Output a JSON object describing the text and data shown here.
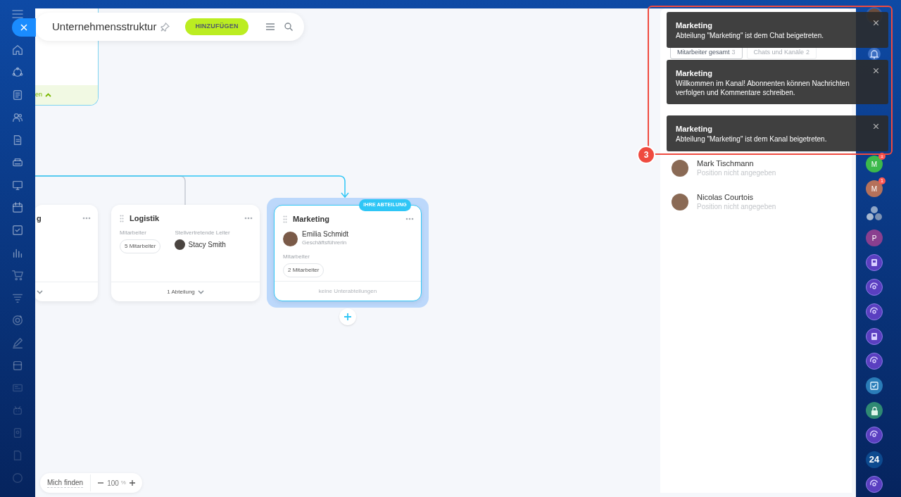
{
  "header": {
    "title": "Unternehmensstruktur",
    "add_button": "HINZUFÜGEN"
  },
  "top_card": {
    "footer_text": "en"
  },
  "departments": [
    {
      "title": "g",
      "selected": false,
      "kind": "collapsed"
    },
    {
      "title": "Logistik",
      "selected": false,
      "members_label": "Mitarbeiter",
      "members": "5 Mitarbeiter",
      "deputy_label": "Stellvertretende Leiter",
      "deputy": "Stacy Smith",
      "footer": "1 Abteilung",
      "kind": "expandable"
    },
    {
      "title": "Marketing",
      "selected": true,
      "badge": "IHRE ABTEILUNG",
      "head": "Emilia Schmidt",
      "head_position": "Geschäftsführerin",
      "members_label": "Mitarbeiter",
      "members": "2 Mitarbeiter",
      "footer": "keine Unterabteilungen",
      "kind": "leaf"
    }
  ],
  "zoom": {
    "find_button": "Mich finden",
    "value": "100",
    "unit": "%"
  },
  "panel": {
    "tabs": [
      {
        "label": "Mitarbeiter gesamt",
        "count": "3",
        "selected": true
      },
      {
        "label": "Chats und Kanäle",
        "count": "2",
        "selected": false
      }
    ],
    "employees": [
      {
        "name": "Mark Tischmann",
        "position": "Position nicht angegeben"
      },
      {
        "name": "Nicolas Courtois",
        "position": "Position nicht angegeben"
      }
    ]
  },
  "notifications": [
    {
      "title": "Marketing",
      "text": "Abteilung \"Marketing\" ist dem Chat beigetreten."
    },
    {
      "title": "Marketing",
      "text": "Willkommen im Kanal! Abonnenten können Nachrichten verfolgen und Kommentare schreiben."
    },
    {
      "title": "Marketing",
      "text": "Abteilung \"Marketing\" ist dem Kanal beigetreten."
    }
  ],
  "annotation": {
    "number": "3"
  },
  "rail": [
    {
      "kind": "letter",
      "text": "M",
      "color": "#3cb94b",
      "badge": "1"
    },
    {
      "kind": "letter",
      "text": "M",
      "color": "#b5715a",
      "badge": "1"
    },
    {
      "kind": "group"
    },
    {
      "kind": "letter",
      "text": "P",
      "color": "#8a3f8f"
    },
    {
      "kind": "book"
    },
    {
      "kind": "channel"
    },
    {
      "kind": "channel"
    },
    {
      "kind": "book"
    },
    {
      "kind": "channel"
    },
    {
      "kind": "task"
    },
    {
      "kind": "lock"
    },
    {
      "kind": "channel"
    },
    {
      "kind": "letter",
      "text": "24",
      "color": "#0d4a8f"
    },
    {
      "kind": "channel"
    }
  ]
}
